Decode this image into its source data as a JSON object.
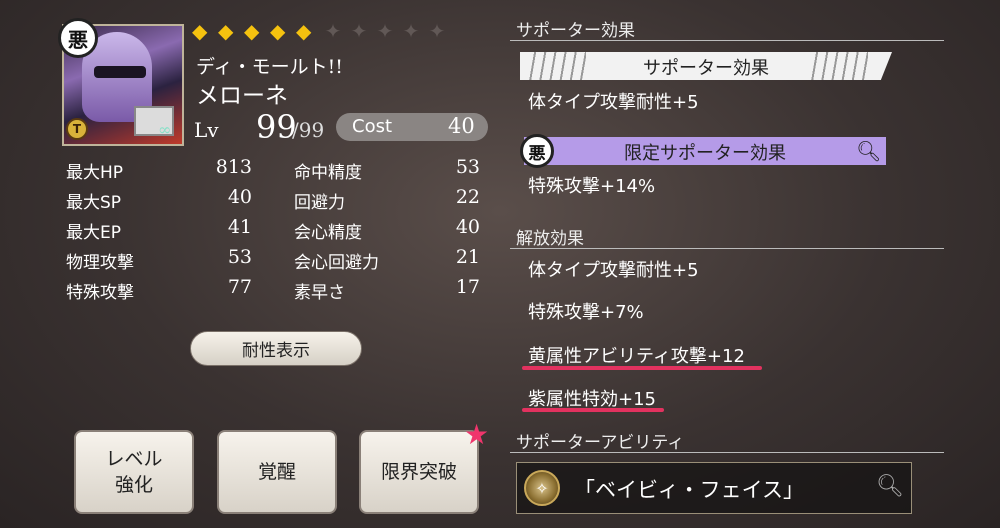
{
  "character": {
    "alignment_badge": "悪",
    "rank_badge": "T",
    "name_line1": "ディ・モールト!!",
    "name_line2": "メローネ",
    "rarity_filled": 5,
    "rarity_total": 10,
    "level_label": "Lv",
    "level": "99",
    "level_max": "/99",
    "cost_label": "Cost",
    "cost": "40"
  },
  "stats_left": [
    {
      "label": "最大HP",
      "value": "813"
    },
    {
      "label": "最大SP",
      "value": "40"
    },
    {
      "label": "最大EP",
      "value": "41"
    },
    {
      "label": "物理攻撃",
      "value": "53"
    },
    {
      "label": "特殊攻撃",
      "value": "77"
    }
  ],
  "stats_right": [
    {
      "label": "命中精度",
      "value": "53"
    },
    {
      "label": "回避力",
      "value": "22"
    },
    {
      "label": "会心精度",
      "value": "40"
    },
    {
      "label": "会心回避力",
      "value": "21"
    },
    {
      "label": "素早さ",
      "value": "17"
    }
  ],
  "buttons": {
    "resistance": "耐性表示",
    "level_up_1": "レベル",
    "level_up_2": "強化",
    "awaken": "覚醒",
    "limit_break": "限界突破"
  },
  "supporter": {
    "section_title": "サポーター効果",
    "banner": "サポーター効果",
    "effect": "体タイプ攻撃耐性+5",
    "limited_badge": "悪",
    "limited_banner": "限定サポーター効果",
    "limited_effect": "特殊攻撃+14%"
  },
  "release": {
    "section_title": "解放効果",
    "effects": [
      "体タイプ攻撃耐性+5",
      "特殊攻撃+7%",
      "黄属性アビリティ攻撃+12",
      "紫属性特効+15"
    ]
  },
  "ability": {
    "section_title": "サポーターアビリティ",
    "name": "「ベイビィ・フェイス」"
  },
  "colors": {
    "gold": "#f5c20f",
    "purple_banner": "#b59be8",
    "highlight_underline": "#e2325f",
    "limit_break_star": "#f0356c"
  }
}
